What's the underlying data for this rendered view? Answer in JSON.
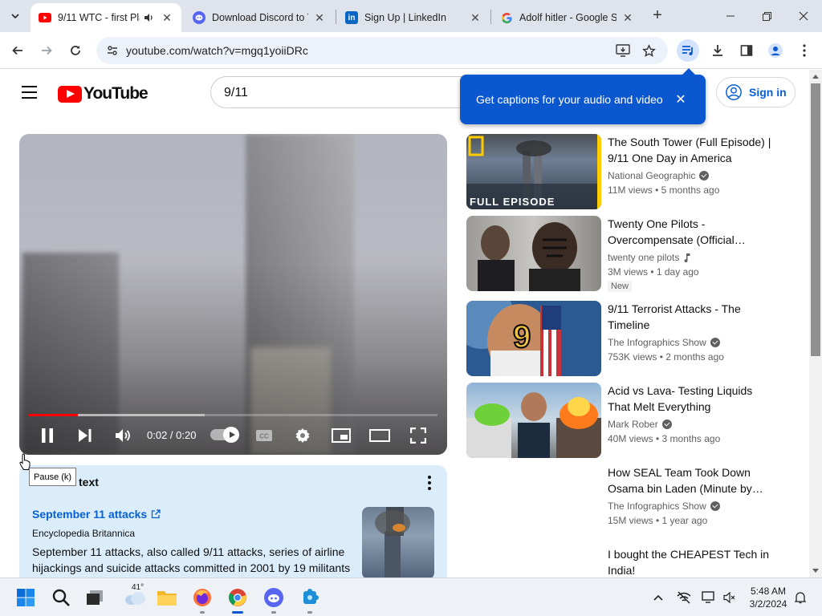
{
  "browser": {
    "tabs": [
      {
        "title": "9/11 WTC - first Pla",
        "favicon": "youtube-icon",
        "active": true
      },
      {
        "title": "Download Discord to T",
        "favicon": "discord-icon"
      },
      {
        "title": "Sign Up | LinkedIn",
        "favicon": "linkedin-icon"
      },
      {
        "title": "Adolf hitler - Google S",
        "favicon": "google-icon"
      }
    ],
    "url": "youtube.com/watch?v=mgq1yoiiDRc"
  },
  "youtube": {
    "logo_text": "YouTube",
    "search_value": "9/11",
    "signin_label": "Sign in",
    "captions_popup": "Get captions for your audio and video"
  },
  "player": {
    "time": "0:02 / 0:20",
    "progress_fraction": 0.12,
    "tooltip": "Pause (k)"
  },
  "context": {
    "header": "text",
    "link": "September 11 attacks",
    "source": "Encyclopedia Britannica",
    "description": "September 11 attacks, also called 9/11 attacks, series of airline hijackings and suicide attacks committed in 2001 by 19 militants"
  },
  "recommendations": [
    {
      "title": "The South Tower (Full Episode) | 9/11 One Day in America",
      "channel": "National Geographic",
      "verified": true,
      "meta": "11M views  •  5 months ago",
      "thumb_label": "FULL EPISODE"
    },
    {
      "title": "Twenty One Pilots - Overcompensate (Official…",
      "channel": "twenty one pilots",
      "music": true,
      "meta": "3M views  •  1 day ago",
      "badge": "New"
    },
    {
      "title": "9/11 Terrorist Attacks - The Timeline",
      "channel": "The Infographics Show",
      "verified": true,
      "meta": "753K views  •  2 months ago"
    },
    {
      "title": "Acid vs Lava- Testing Liquids That Melt Everything",
      "channel": "Mark Rober",
      "verified": true,
      "meta": "40M views  •  3 months ago"
    },
    {
      "title": "How SEAL Team Took Down Osama bin Laden (Minute by…",
      "channel": "The Infographics Show",
      "verified": true,
      "meta": "15M views  •  1 year ago"
    },
    {
      "title": "I bought the CHEAPEST Tech in India!"
    }
  ],
  "taskbar": {
    "weather_temp": "41°",
    "time": "5:48 AM",
    "date": "3/2/2024"
  },
  "colors": {
    "youtube_red": "#ff0000",
    "popup_blue": "#0b57d0",
    "link_blue": "#065fd4"
  }
}
